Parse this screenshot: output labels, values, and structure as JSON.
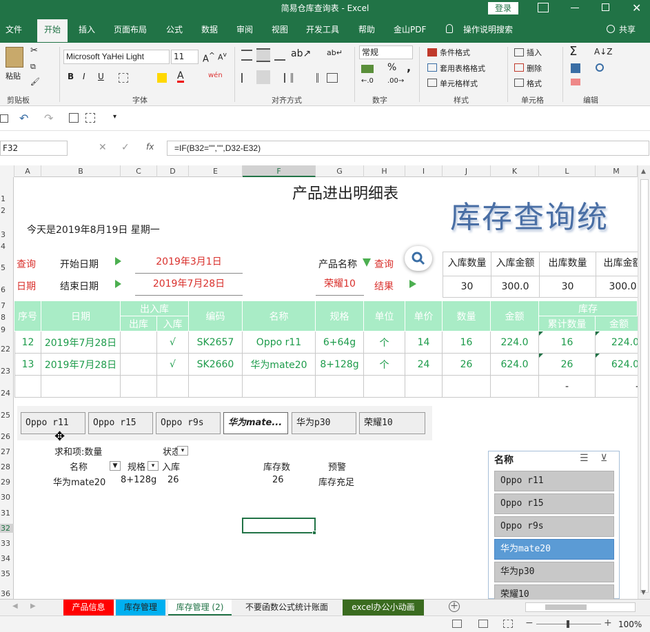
{
  "window": {
    "title": "简易仓库查询表  -  Excel",
    "login_label": "登录"
  },
  "menu": {
    "tabs": [
      "文件",
      "开始",
      "插入",
      "页面布局",
      "公式",
      "数据",
      "审阅",
      "视图",
      "开发工具",
      "帮助",
      "金山PDF",
      "操作说明搜索"
    ],
    "share_label": "共享"
  },
  "ribbon": {
    "paste_label": "粘贴",
    "clipboard_label": "剪贴板",
    "font_name": "Microsoft YaHei Light",
    "font_size": "11",
    "font_group_label": "字体",
    "align_group_label": "对齐方式",
    "number_format": "常规",
    "number_group_label": "数字",
    "cond_format_label": "条件格式",
    "table_format_label": "套用表格格式",
    "cell_style_label": "单元格样式",
    "style_group_label": "样式",
    "insert_label": "插入",
    "delete_label": "删除",
    "format_label": "格式",
    "cells_group_label": "单元格",
    "edit_group_label": "编辑",
    "bold": "B",
    "italic": "I",
    "underline": "U",
    "wen_label": "wén",
    "percent": "%",
    "comma": ","
  },
  "formula_bar": {
    "name_box": "F32",
    "fx": "fx",
    "formula": "=IF(B32=\"\",\"\",D32-E32)"
  },
  "columns": [
    "A",
    "B",
    "C",
    "D",
    "E",
    "F",
    "G",
    "H",
    "I",
    "J",
    "K",
    "L",
    "M"
  ],
  "rows": [
    "1",
    "2",
    "3",
    "4",
    "5",
    "6",
    "7",
    "8",
    "9",
    "22",
    "23",
    "24",
    "25",
    "26",
    "27",
    "28",
    "29",
    "30",
    "31",
    "32",
    "33",
    "34",
    "35",
    "36"
  ],
  "sheet": {
    "title": "产品进出明细表",
    "banner": "库存查询统",
    "today": "今天是2019年8月19日   星期一",
    "query_label": "查询",
    "date_label": "日期",
    "start_label": "开始日期",
    "end_label": "结束日期",
    "start_date": "2019年3月1日",
    "end_date": "2019年7月28日",
    "product_name_label": "产品名称",
    "query_red": "查询",
    "product_value": "荣耀10",
    "result_label": "结果",
    "summary_headers": [
      "入库数量",
      "入库金额",
      "出库数量",
      "出库金额"
    ],
    "summary_values": [
      "30",
      "300.0",
      "30",
      "300.0"
    ],
    "table_headers": {
      "seq": "序号",
      "date": "日期",
      "inout": "出入库",
      "out": "出库",
      "in": "入库",
      "code": "编码",
      "name": "名称",
      "spec": "规格",
      "unit": "单位",
      "price": "单价",
      "qty": "数量",
      "amount": "金额",
      "stock": "库存",
      "cum_qty": "累计数量",
      "stock_amount": "金额"
    },
    "table_rows": [
      {
        "seq": "12",
        "date": "2019年7月28日",
        "out": "",
        "in": "√",
        "code": "SK2657",
        "name": "Oppo r11",
        "spec": "6+64g",
        "unit": "个",
        "price": "14",
        "qty": "16",
        "amount": "224.0",
        "cum_qty": "16",
        "stock_amount": "224.0"
      },
      {
        "seq": "13",
        "date": "2019年7月28日",
        "out": "",
        "in": "√",
        "code": "SK2660",
        "name": "华为mate20",
        "spec": "8+128g",
        "unit": "个",
        "price": "24",
        "qty": "26",
        "amount": "624.0",
        "cum_qty": "26",
        "stock_amount": "624.0"
      },
      {
        "seq": "",
        "date": "",
        "out": "",
        "in": "",
        "code": "",
        "name": "",
        "spec": "",
        "unit": "",
        "price": "",
        "qty": "",
        "amount": "",
        "cum_qty": "-",
        "stock_amount": "-"
      }
    ],
    "slicer_buttons": [
      "Oppo r11",
      "Oppo r15",
      "Oppo r9s",
      "华为mate...",
      "华为p30",
      "荣耀10"
    ],
    "pivot": {
      "sum_label": "求和项:数量",
      "status_label": "状态",
      "name_col": "名称",
      "spec_col": "规格",
      "in_col": "入库",
      "stock_col": "库存数",
      "alert_col": "预警",
      "row_name": "华为mate20",
      "row_spec": "8+128g",
      "row_in": "26",
      "row_stock": "26",
      "row_alert": "库存充足"
    },
    "slicer_panel": {
      "title": "名称",
      "items": [
        "Oppo r11",
        "Oppo r15",
        "Oppo r9s",
        "华为mate20",
        "华为p30",
        "荣耀10"
      ],
      "selected_index": 3
    }
  },
  "sheet_tabs": [
    {
      "label": "产品信息",
      "bg": "#ff0000",
      "color": "#ffffff"
    },
    {
      "label": "库存管理",
      "bg": "#00b0f0",
      "color": "#222222"
    },
    {
      "label": "库存管理 (2)",
      "bg": "#ffffff",
      "color": "#217346"
    },
    {
      "label": "不要函数公式统计账面",
      "bg": "#f0f0f0",
      "color": "#222222"
    },
    {
      "label": "excel办公小动画",
      "bg": "#3a6b1f",
      "color": "#ffffff"
    }
  ],
  "status": {
    "zoom": "100%"
  },
  "colors": {
    "excel_green": "#217346",
    "table_header": "#a9ecc6",
    "table_text": "#1c9b4a",
    "red_label": "#d9302c",
    "selected_item": "#5b9bd5"
  }
}
